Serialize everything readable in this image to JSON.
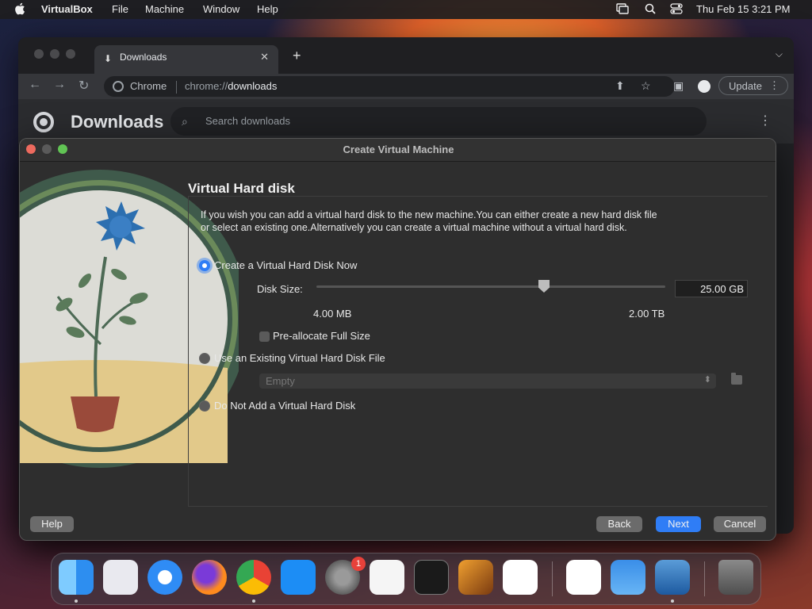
{
  "menubar": {
    "app_name": "VirtualBox",
    "menus": [
      "File",
      "Machine",
      "Window",
      "Help"
    ],
    "clock": "Thu Feb 15  3:21 PM"
  },
  "chrome": {
    "tab_title": "Downloads",
    "omnibox_chip": "Chrome",
    "url_scheme": "chrome://",
    "url_host": "downloads",
    "update_label": "Update",
    "page_title": "Downloads",
    "search_placeholder": "Search downloads"
  },
  "dialog": {
    "window_title": "Create Virtual Machine",
    "heading": "Virtual Hard disk",
    "description": "If you wish you can add a virtual hard disk to the new machine.You can either create a new hard disk file or select an existing one.Alternatively you can create a virtual machine without a virtual hard disk.",
    "options": {
      "create_now": "Create a Virtual Hard Disk Now",
      "use_existing": "Use an Existing Virtual Hard Disk File",
      "do_not_add": "Do Not Add a Virtual Hard Disk"
    },
    "selected_option": "create_now",
    "disk_size_label": "Disk Size:",
    "disk_size_value": "25.00 GB",
    "slider_min_label": "4.00 MB",
    "slider_max_label": "2.00 TB",
    "slider_position_fraction": 0.65,
    "preallocate_label": "Pre-allocate Full Size",
    "preallocate_checked": false,
    "existing_file_value": "Empty",
    "buttons": {
      "help": "Help",
      "back": "Back",
      "next": "Next",
      "cancel": "Cancel"
    }
  },
  "dock": {
    "apps": [
      "Finder",
      "Launchpad",
      "Safari",
      "Firefox",
      "Google Chrome",
      "App Store",
      "System Settings",
      "TextEdit",
      "Terminal",
      "GarageBand",
      "Visual Studio Code",
      "Visual Studio",
      "Weather",
      "VirtualBox",
      "Trash"
    ],
    "settings_badge": "1"
  },
  "colors": {
    "accent": "#2f7df6",
    "dialog_bg": "#2e2e2e",
    "chrome_bg": "#202124"
  }
}
